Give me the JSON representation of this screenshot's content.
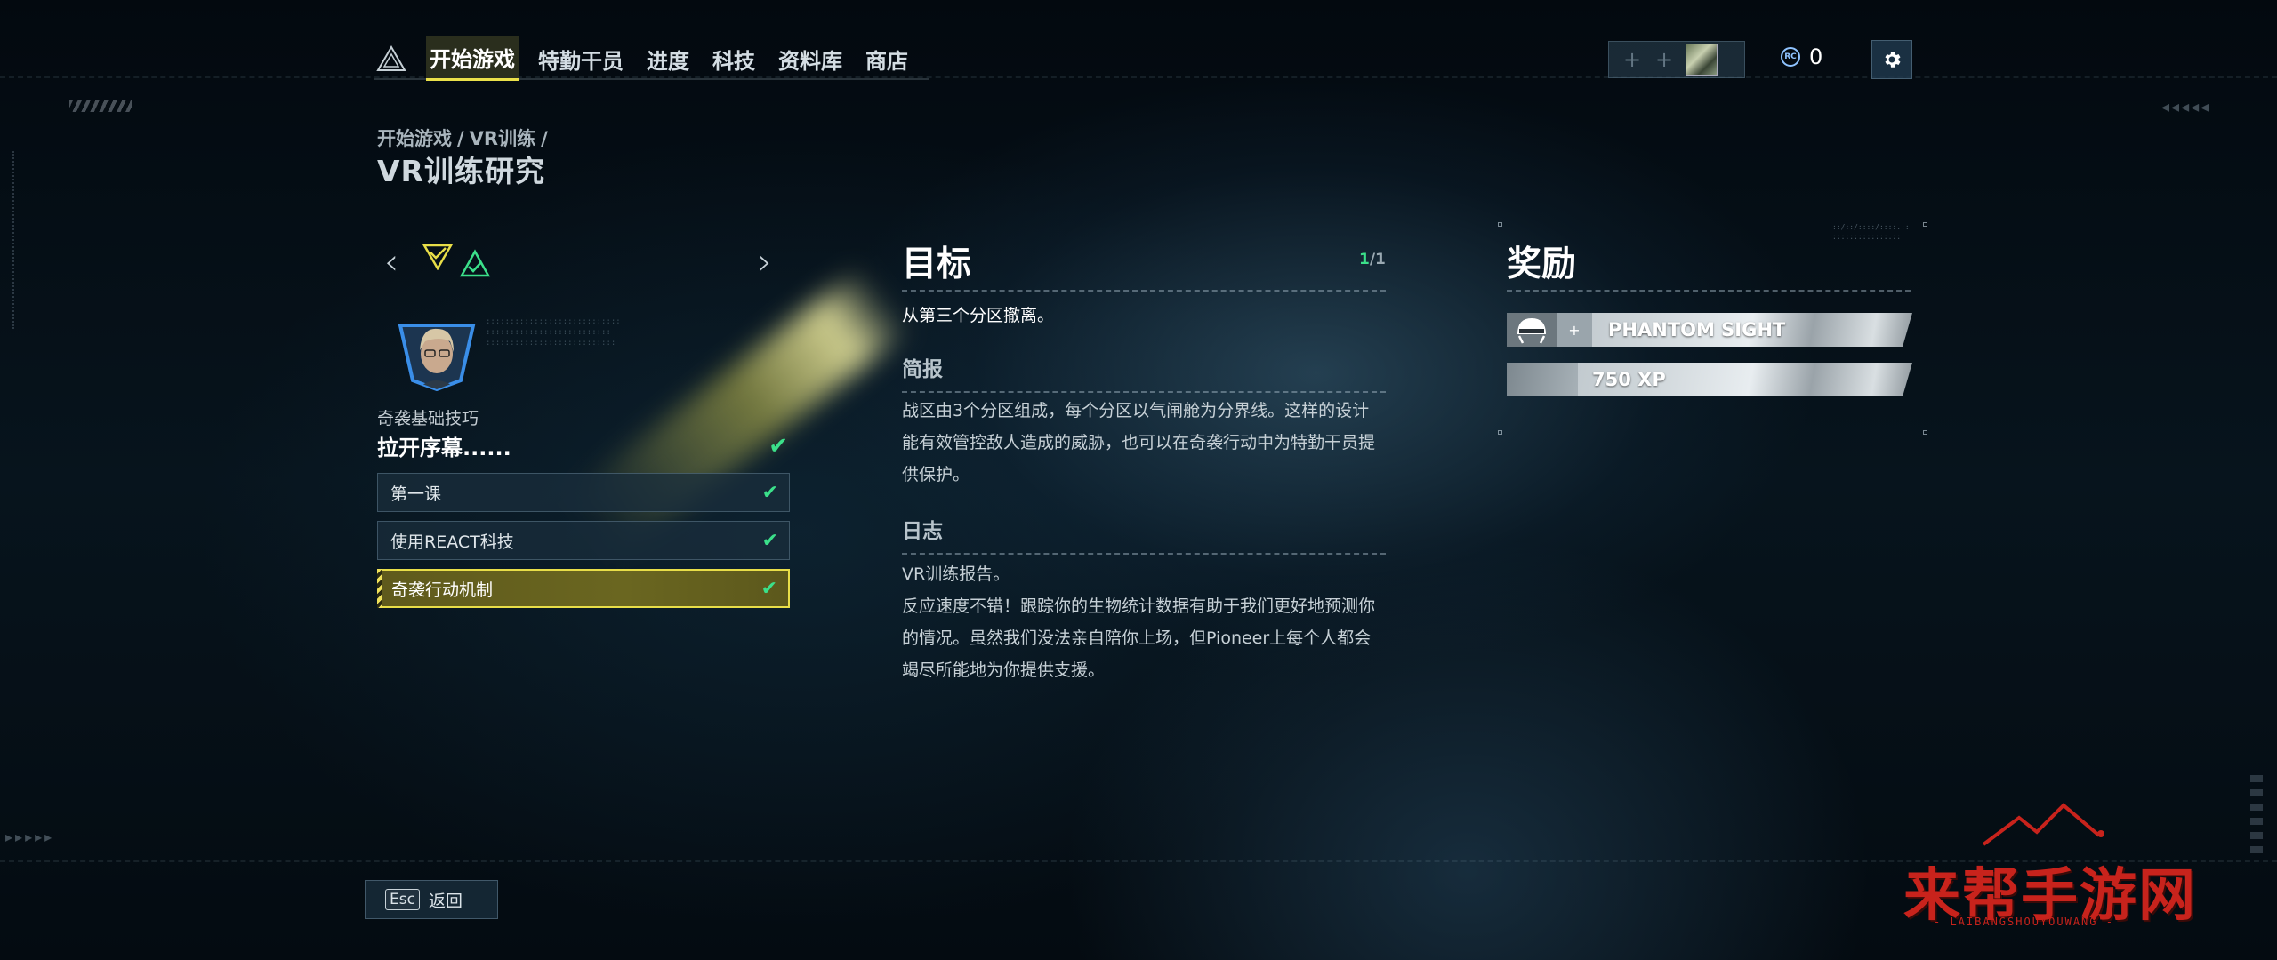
{
  "nav": {
    "tabs": [
      {
        "label": "开始游戏",
        "active": true
      },
      {
        "label": "特勤干员",
        "active": false
      },
      {
        "label": "进度",
        "active": false
      },
      {
        "label": "科技",
        "active": false
      },
      {
        "label": "资料库",
        "active": false
      },
      {
        "label": "商店",
        "active": false
      }
    ]
  },
  "party": {
    "slot_symbol": "+"
  },
  "currency": {
    "icon_text": "RC",
    "amount": "0"
  },
  "breadcrumb": [
    "开始游戏",
    "/",
    "VR训练",
    "/"
  ],
  "page_title": "VR训练研究",
  "mission": {
    "category": "奇袭基础技巧",
    "title": "拉开序幕......",
    "lessons": [
      {
        "label": "第一课",
        "completed": true,
        "active": false
      },
      {
        "label": "使用REACT科技",
        "completed": true,
        "active": false
      },
      {
        "label": "奇袭行动机制",
        "completed": true,
        "active": true
      }
    ]
  },
  "objectives": {
    "heading": "目标",
    "counter_current": "1",
    "counter_total": "/1",
    "text": "从第三个分区撤离。",
    "briefing_heading": "简报",
    "briefing_text": "战区由3个分区组成，每个分区以气闸舱为分界线。这样的设计能有效管控敌人造成的威胁，也可以在奇袭行动中为特勤干员提供保护。",
    "log_heading": "日志",
    "log_line1": "VR训练报告。",
    "log_text": "反应速度不错！跟踪你的生物统计数据有助于我们更好地预测你的情况。虽然我们没法亲自陪你上场，但Pioneer上每个人都会竭尽所能地为你提供支援。"
  },
  "rewards": {
    "heading": "奖励",
    "items": [
      {
        "label": "PHANTOM SIGHT",
        "icon": "helmet-icon",
        "plus": "+"
      },
      {
        "label": "750 XP",
        "icon": "xp-icon"
      }
    ]
  },
  "back_button": {
    "key": "Esc",
    "label": "返回"
  },
  "watermark": {
    "text": "来帮手游网",
    "sub": "- LAIBANGSHOUYOUWANG -"
  },
  "colors": {
    "accent_yellow": "#e8de48",
    "check_green": "#3be08a",
    "watermark_red": "#c8231c"
  }
}
